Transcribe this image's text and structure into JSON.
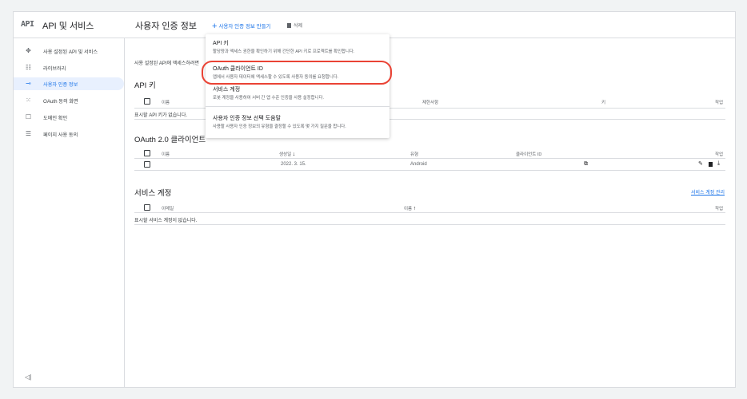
{
  "header": {
    "logo": "API",
    "app_title": "API 및 서비스",
    "page_title": "사용자 인증 정보",
    "create_label": "사용자 인증 정보 만들기",
    "delete_label": "삭제"
  },
  "sidebar": {
    "items": [
      {
        "label": "사용 설정된 API 및 서비스",
        "icon": "diamond-icon",
        "glyph": "✥"
      },
      {
        "label": "라이브러리",
        "icon": "library-icon",
        "glyph": "☷"
      },
      {
        "label": "사용자 인증 정보",
        "icon": "key-icon",
        "glyph": "⊸",
        "active": true
      },
      {
        "label": "OAuth 동의 화면",
        "icon": "consent-icon",
        "glyph": "⁙"
      },
      {
        "label": "도메인 확인",
        "icon": "domain-check-icon",
        "glyph": "☐"
      },
      {
        "label": "페이지 사용 동의",
        "icon": "page-consent-icon",
        "glyph": "☰"
      }
    ],
    "collapse_glyph": "◁|"
  },
  "main": {
    "intro": "사용 설정된 API에 액세스하려면",
    "api_keys": {
      "title": "API 키",
      "col_name": "이름",
      "col_restriction": "제한사항",
      "col_key": "키",
      "col_actions": "작업",
      "empty": "표시할 API 키가 없습니다."
    },
    "oauth": {
      "title": "OAuth 2.0 클라이언트",
      "col_name": "이름",
      "col_created": "생성일",
      "col_type": "유형",
      "col_client_id": "클라이언트 ID",
      "col_actions": "작업",
      "rows": [
        {
          "name": "",
          "created": "2022. 3. 15.",
          "type": "Android"
        }
      ]
    },
    "service_accounts": {
      "title": "서비스 계정",
      "manage_link": "서비스 계정 관리",
      "col_email": "이메일",
      "col_name": "이름",
      "col_actions": "작업",
      "empty": "표시할 서비스 계정이 없습니다."
    }
  },
  "menu": {
    "items": [
      {
        "title": "API 키",
        "desc": "할당량과 액세스 권한을 확인하기 위해 간단한 API 키로 프로젝트를 확인합니다."
      },
      {
        "title": "OAuth 클라이언트 ID",
        "desc": "앱에서 사용자 데이터에 액세스할 수 있도록 사용자 동의를 요청합니다."
      },
      {
        "title": "서비스 계정",
        "desc": "로봇 계정을 사용하여 서버 간 앱 수준 인증을 사용 설정합니다."
      },
      {
        "title": "사용자 인증 정보 선택 도움말",
        "desc": "사용할 사용자 인증 정보의 유형을 결정할 수 있도록 몇 가지 질문을 합니다."
      }
    ]
  },
  "colors": {
    "accent": "#1a73e8",
    "highlight": "#ea4335"
  }
}
